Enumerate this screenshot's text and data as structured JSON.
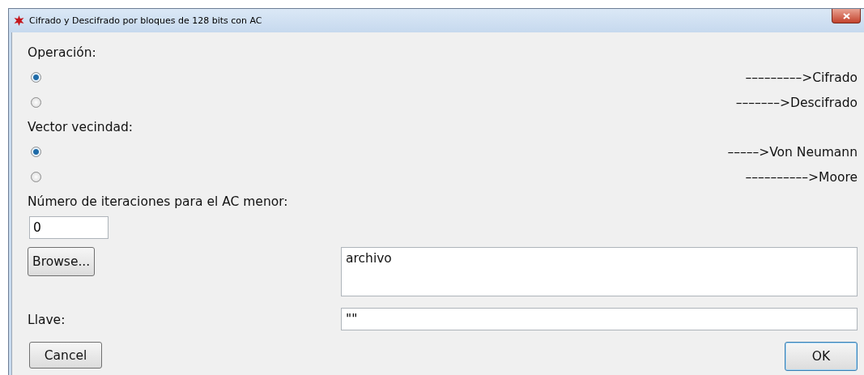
{
  "window": {
    "title": "Cifrado y Descifrado por bloques de 128 bits con AC"
  },
  "groups": [
    {
      "label": "Operación:",
      "options": [
        {
          "label": "–––––––––>Cifrado",
          "selected": true
        },
        {
          "label": "–––––––>Descifrado",
          "selected": false
        }
      ]
    },
    {
      "label": "Vector vecindad:",
      "options": [
        {
          "label": "–––––>Von Neumann",
          "selected": true
        },
        {
          "label": "––––––––––>Moore",
          "selected": false
        }
      ]
    }
  ],
  "iterations": {
    "label": "Número de iteraciones para el AC menor:",
    "value": "0"
  },
  "browse": {
    "button": "Browse...",
    "value": "archivo"
  },
  "key": {
    "label": "Llave:",
    "value": "\"\""
  },
  "buttons": {
    "cancel": "Cancel",
    "ok": "OK"
  }
}
